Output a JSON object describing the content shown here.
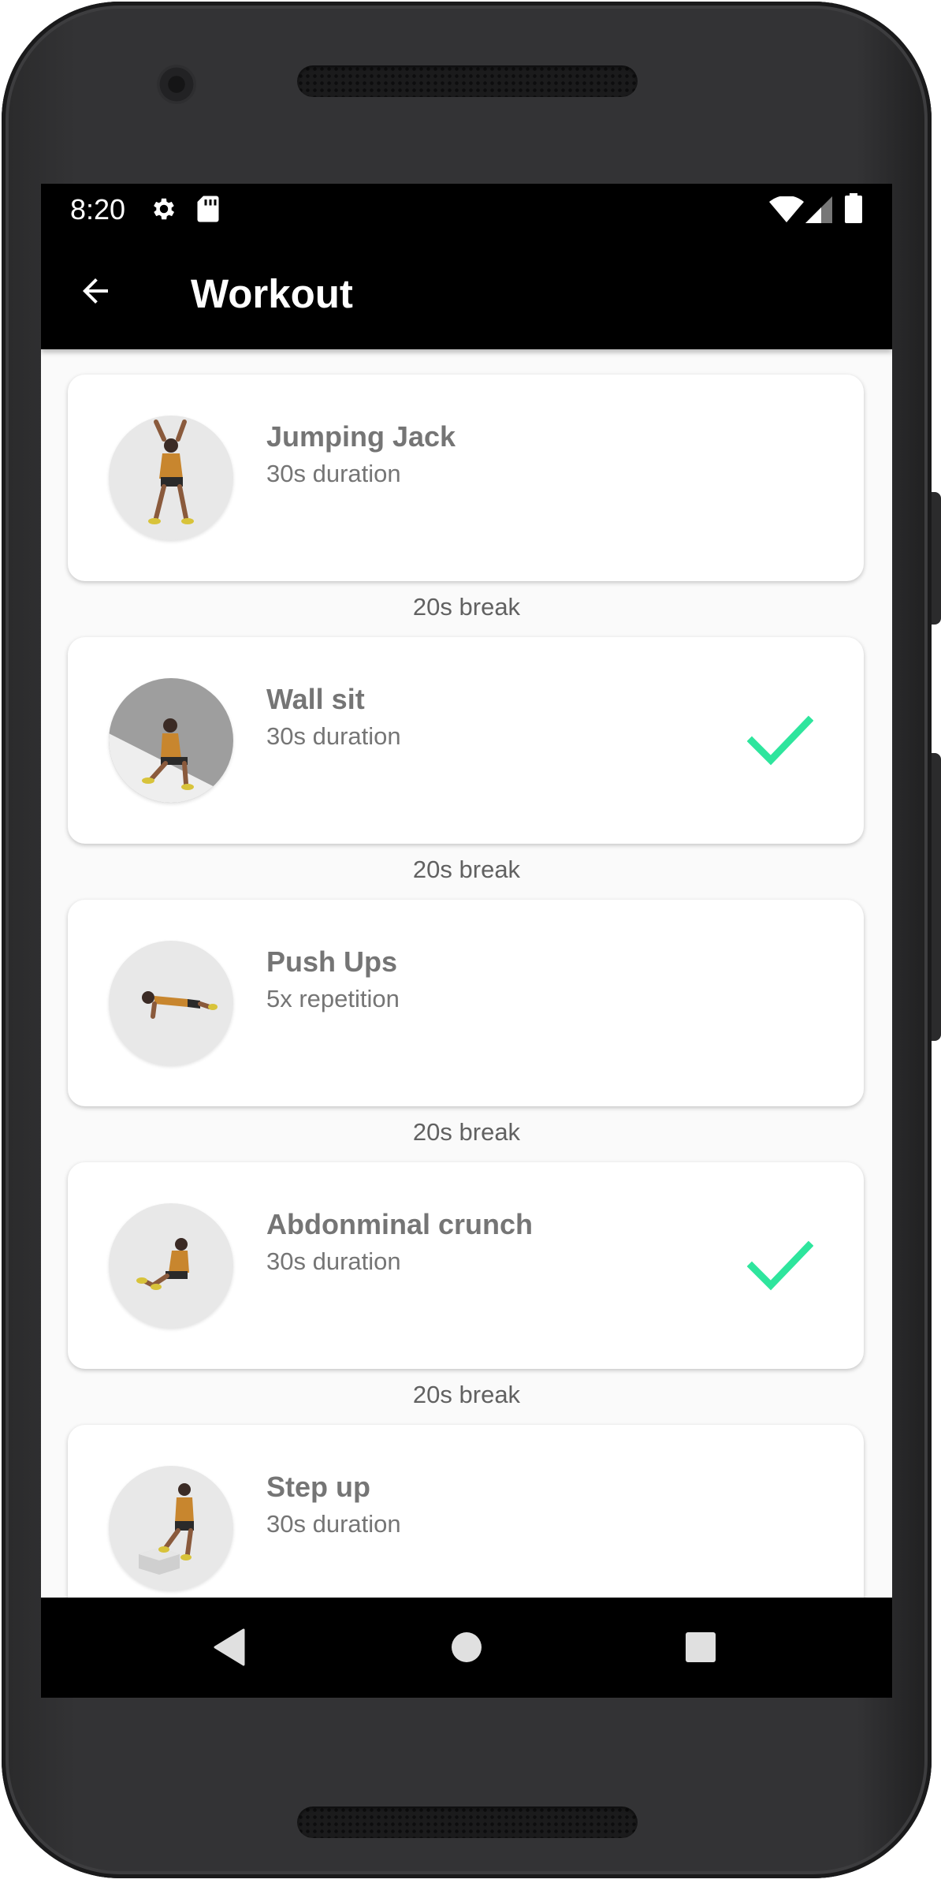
{
  "status": {
    "time": "8:20",
    "icons": [
      "settings-icon",
      "sd-card-icon",
      "wifi-icon",
      "signal-icon",
      "battery-icon"
    ]
  },
  "appbar": {
    "title": "Workout",
    "back_icon": "arrow-back-icon"
  },
  "colors": {
    "accent_check": "#2ee59d",
    "app_bar": "#000000",
    "text_gray": "#757575"
  },
  "exercises": [
    {
      "name": "Jumping Jack",
      "detail": "30s duration",
      "completed": false,
      "icon": "jumping-jack-figure"
    },
    {
      "name": "Wall sit",
      "detail": "30s duration",
      "completed": true,
      "icon": "wall-sit-figure"
    },
    {
      "name": "Push Ups",
      "detail": "5x repetition",
      "completed": false,
      "icon": "push-up-figure"
    },
    {
      "name": "Abdonminal crunch",
      "detail": "30s duration",
      "completed": true,
      "icon": "crunch-figure"
    },
    {
      "name": "Step up",
      "detail": "30s duration",
      "completed": false,
      "icon": "step-up-figure"
    }
  ],
  "breaks": [
    "20s break",
    "20s break",
    "20s break",
    "20s break"
  ],
  "navbar": {
    "icons": [
      "back-triangle-icon",
      "home-circle-icon",
      "recents-square-icon"
    ]
  }
}
